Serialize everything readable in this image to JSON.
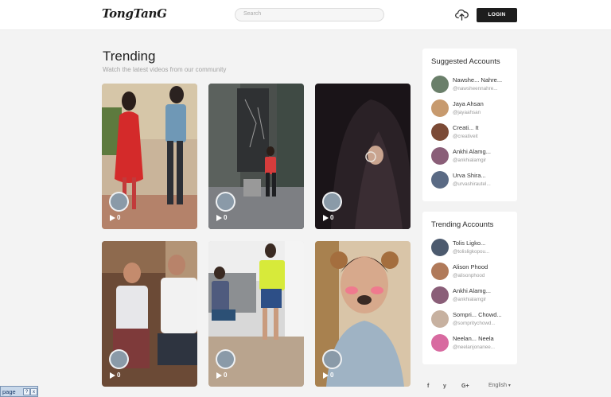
{
  "header": {
    "logo": "TongTanG",
    "search_placeholder": "Search",
    "login_label": "LOGIN",
    "upload_icon": "cloud-upload-icon"
  },
  "main": {
    "title": "Trending",
    "subtitle": "Watch the latest videos from our community",
    "videos": [
      {
        "views": "0"
      },
      {
        "views": "0"
      },
      {
        "views": "0"
      },
      {
        "views": "0"
      },
      {
        "views": "0"
      },
      {
        "views": "0"
      }
    ]
  },
  "suggested": {
    "title": "Suggested Accounts",
    "accounts": [
      {
        "name": "Nawshe... Nahre...",
        "handle": "@nawsheennahre..."
      },
      {
        "name": "Jaya Ahsan",
        "handle": "@jayaahsan"
      },
      {
        "name": "Creati... It",
        "handle": "@creativeit"
      },
      {
        "name": "Ankhi Alamg...",
        "handle": "@ankhialamgir"
      },
      {
        "name": "Urva Shira...",
        "handle": "@urvashirautel..."
      }
    ]
  },
  "trending_accounts": {
    "title": "Trending Accounts",
    "accounts": [
      {
        "name": "Tolis Ligko...",
        "handle": "@tolisligkopou..."
      },
      {
        "name": "Alison Phood",
        "handle": "@alisonphood"
      },
      {
        "name": "Ankhi Alamg...",
        "handle": "@ankhialamgir"
      },
      {
        "name": "Sompri... Chowd...",
        "handle": "@sompritychowd..."
      },
      {
        "name": "Neelan... Neela",
        "handle": "@neelanjonanee..."
      }
    ]
  },
  "footer": {
    "social": [
      "f",
      "y",
      "G+"
    ],
    "language": "English"
  },
  "taskbar": {
    "label": "page",
    "buttons": [
      "?",
      "x"
    ]
  }
}
